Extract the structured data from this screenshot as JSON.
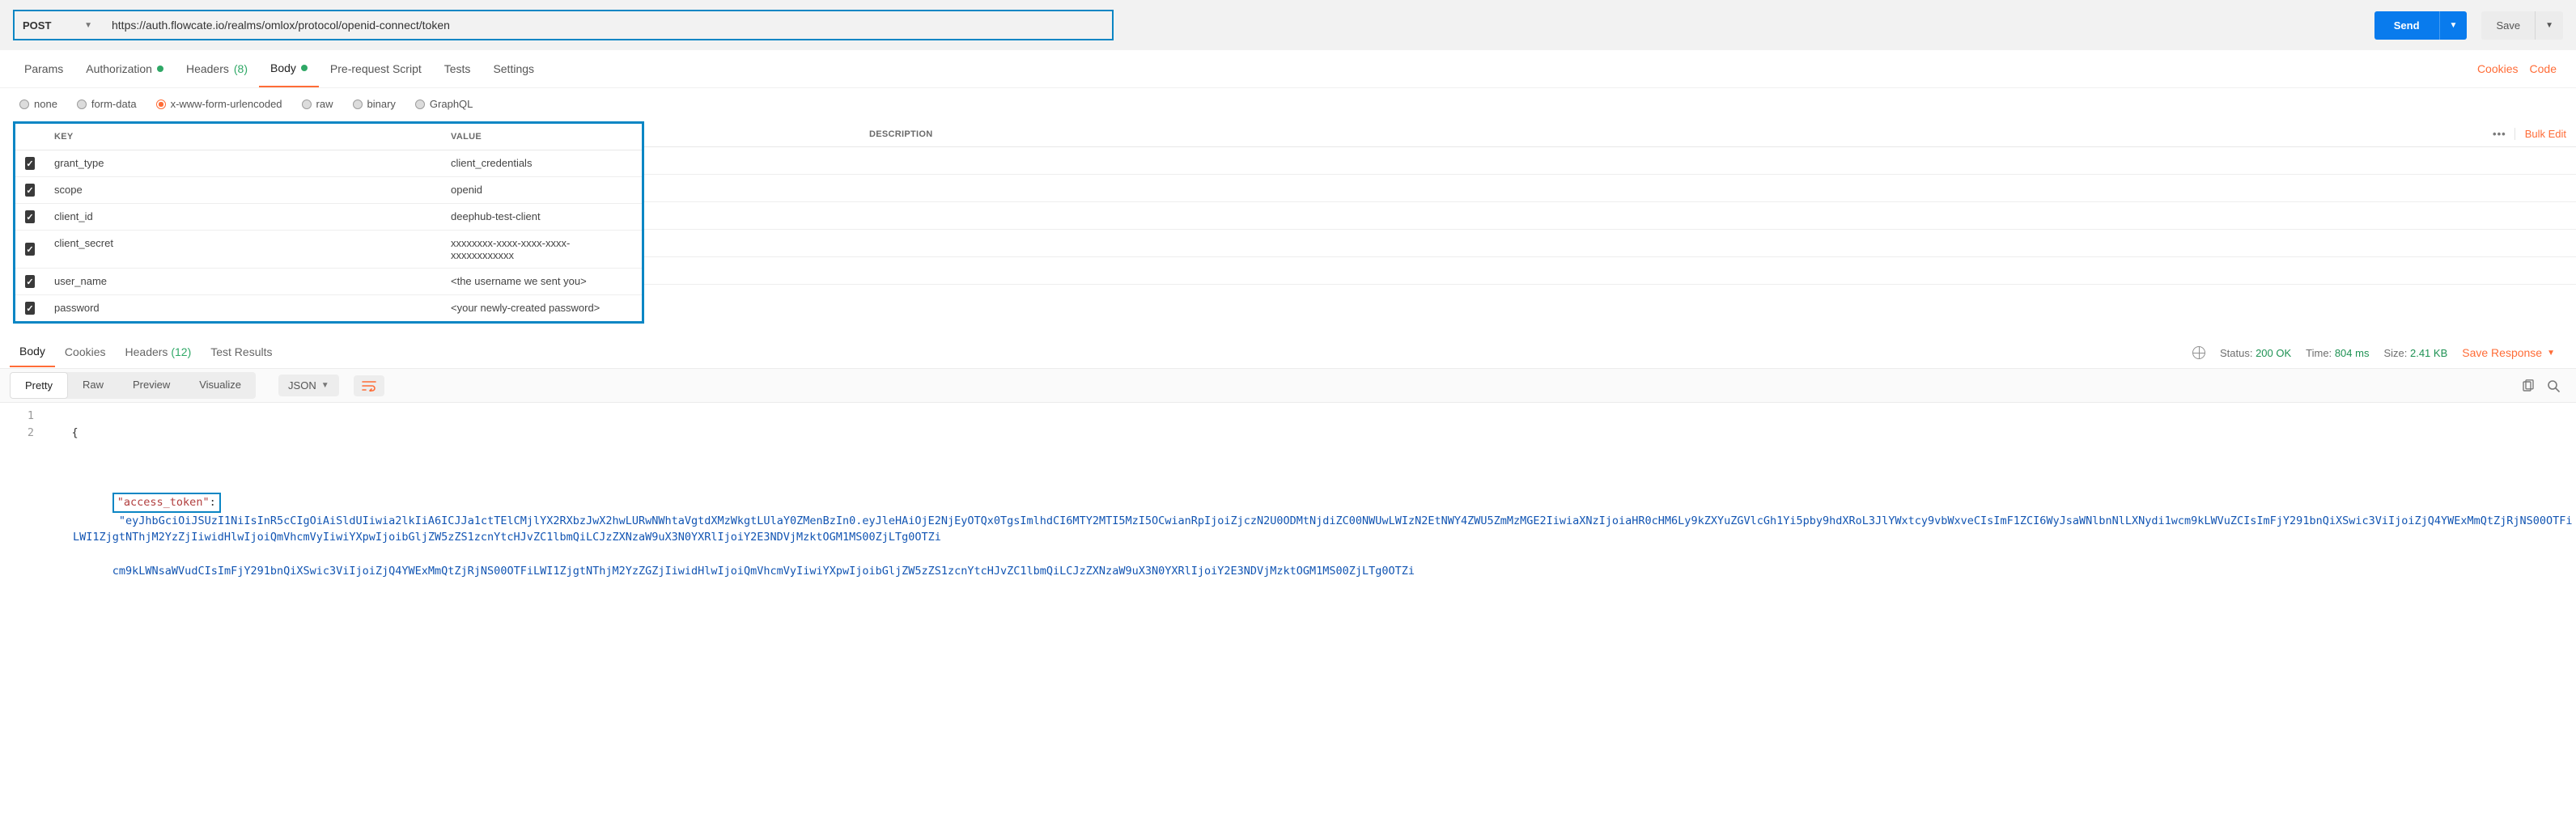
{
  "request": {
    "method": "POST",
    "url": "https://auth.flowcate.io/realms/omlox/protocol/openid-connect/token",
    "send": "Send",
    "save": "Save"
  },
  "tabs": {
    "params": "Params",
    "authorization": "Authorization",
    "headers": "Headers",
    "headers_count": "(8)",
    "body": "Body",
    "preRequest": "Pre-request Script",
    "tests": "Tests",
    "settings": "Settings",
    "cookies": "Cookies",
    "code": "Code"
  },
  "bodyTypes": {
    "none": "none",
    "formData": "form-data",
    "urlencoded": "x-www-form-urlencoded",
    "raw": "raw",
    "binary": "binary",
    "graphql": "GraphQL"
  },
  "kv": {
    "keyHeader": "KEY",
    "valueHeader": "VALUE",
    "descHeader": "DESCRIPTION",
    "bulk": "Bulk Edit",
    "rows": [
      {
        "k": "grant_type",
        "v": "client_credentials"
      },
      {
        "k": "scope",
        "v": "openid"
      },
      {
        "k": "client_id",
        "v": "deephub-test-client"
      },
      {
        "k": "client_secret",
        "v": "xxxxxxxx-xxxx-xxxx-xxxx-xxxxxxxxxxxx"
      },
      {
        "k": "user_name",
        "v": "<the username we sent you>"
      },
      {
        "k": "password",
        "v": "<your newly-created password>"
      }
    ]
  },
  "response": {
    "tabs": {
      "body": "Body",
      "cookies": "Cookies",
      "headers": "Headers",
      "headers_count": "(12)",
      "tests": "Test Results"
    },
    "statusLabel": "Status:",
    "statusValue": "200 OK",
    "timeLabel": "Time:",
    "timeValue": "804 ms",
    "sizeLabel": "Size:",
    "sizeValue": "2.41 KB",
    "saveResponse": "Save Response",
    "viewer": {
      "pretty": "Pretty",
      "raw": "Raw",
      "preview": "Preview",
      "visualize": "Visualize",
      "json": "JSON"
    },
    "lineNumbers": {
      "l1": "1",
      "l2": "2"
    },
    "code": {
      "brace": "{",
      "key": "\"access_token\"",
      "colon": ":",
      "value": "\"eyJhbGciOiJSUzI1NiIsInR5cCIgOiAiSldUIiwia2lkIiA6ICJJa1ctTElCMjlYX2RXbzJwX2hwLURwNWhtaVgtdXMzWkgtLUlaY0ZMenBzIn0.eyJleHAiOjE2NjEyOTQx0TgsImlhdCI6MTY2MTI5MzI5OCwianRpIjoiZjczN2U0ODMtNjdiZC00NWUwLWIzN2EtNWY4ZWU5ZmMzMGE2IiwiaXNzIjoiaHR0cHM6Ly9kZXYuZGVlcGh1Yi5pby9hdXRoL3JlYWxtcy9vbWxveCIsImF1ZCI6WyJsaWNlbnNlLXNydi1wcm9kLWVuZCIsImFjY291bnQiXSwic3ViIjoiZjQ4YWExMmQtZjRjNS00OTFiLWI1ZjgtNThjM2YzZjIiwidHlwIjoiQmVhcmVyIiwiYXpwIjoibGljZW5zZS1zcnYtcHJvZC1lbmQiLCJzZXNzaW9uX3N0YXRlIjoiY2E3NDVjMzktOGM1MS00ZjLTg0OTZi",
      "value_l2": "cm9kLWNsaWVudCIsImFjY291bnQiXSwic3ViIjoiZjQ4YWExMmQtZjRjNS00OTFiLWI1ZjgtNThjM2YzZGZjIiwidHlwIjoiQmVhcmVyIiwiYXpwIjoibGljZW5zZS1zcnYtcHJvZC1lbmQiLCJzZXNzaW9uX3N0YXRlIjoiY2E3NDVjMzktOGM1MS00ZjLTg0OTZi"
    }
  }
}
